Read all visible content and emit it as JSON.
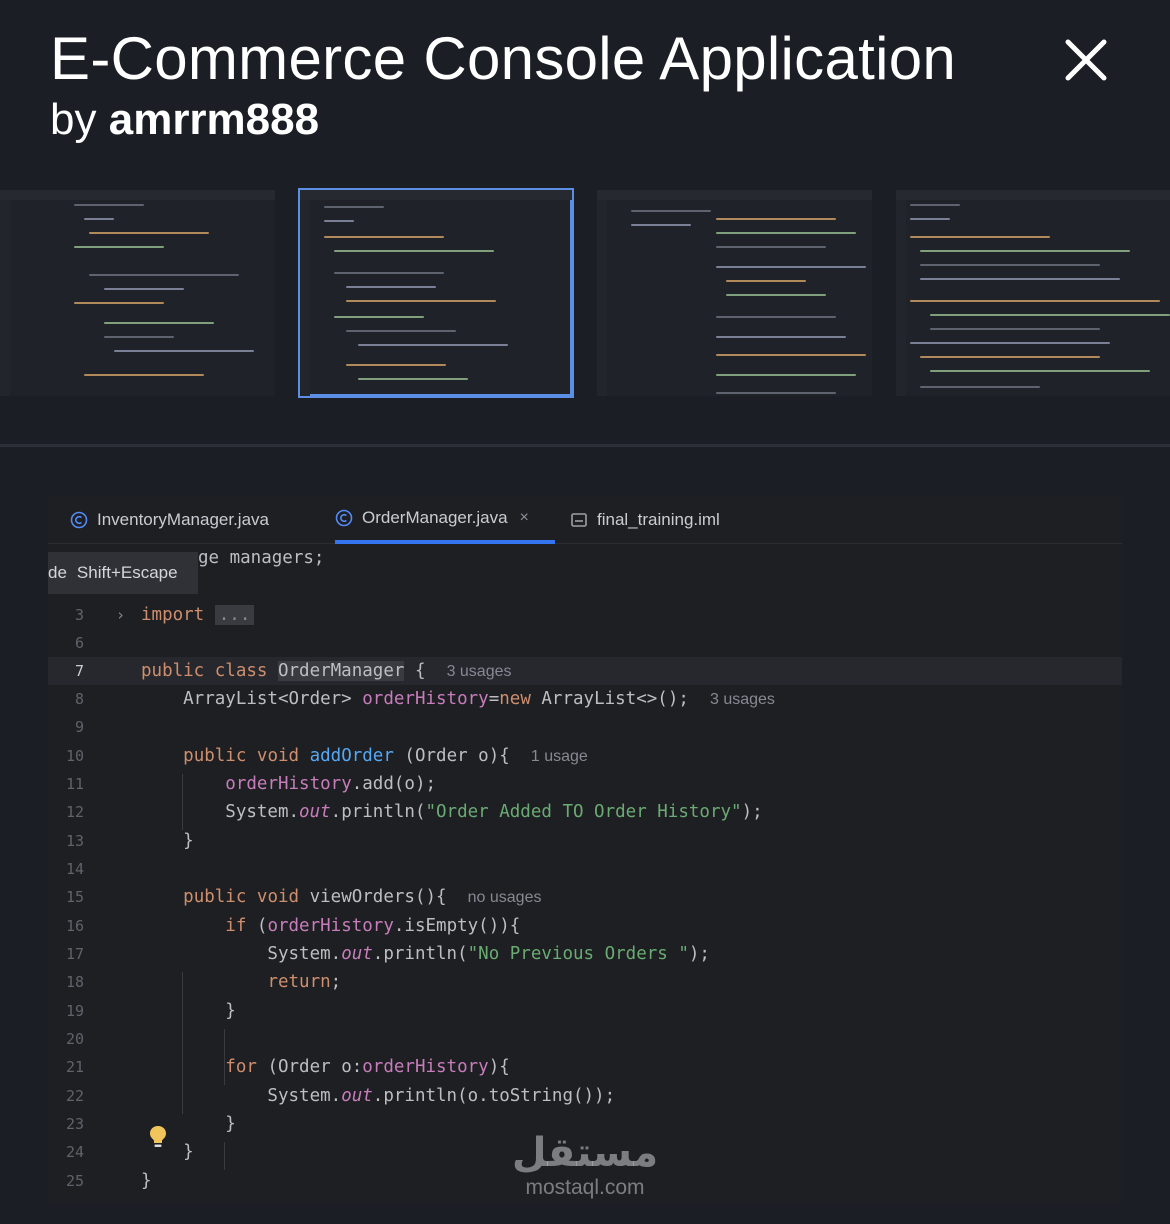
{
  "header": {
    "title": "E-Commerce Console Application",
    "by_prefix": "by",
    "author": "amrrm888",
    "close_icon": "close-icon"
  },
  "thumbnails": {
    "count": 4,
    "selected_index": 1
  },
  "editor": {
    "tabs": [
      {
        "label": "InventoryManager.java",
        "icon": "class-file-icon",
        "active": false
      },
      {
        "label": "OrderManager.java",
        "icon": "class-file-icon",
        "active": true,
        "closable": true
      },
      {
        "label": "final_training.iml",
        "icon": "module-file-icon",
        "active": false
      }
    ],
    "close_tab_glyph": "×",
    "tooltip": {
      "cut_text": "de",
      "shortcut": "Shift+Escape"
    },
    "current_line": "7",
    "lines": [
      {
        "n": "",
        "tokens": [
          {
            "t": "ge managers;"
          }
        ]
      },
      {
        "n": "3",
        "tokens": [
          {
            "t": "import",
            "c": "kw"
          },
          {
            "t": " "
          },
          {
            "t": "...",
            "c": "fold-box"
          }
        ]
      },
      {
        "n": "6",
        "tokens": []
      },
      {
        "n": "7",
        "tokens": [
          {
            "t": "public class ",
            "c": "kw"
          },
          {
            "t": "OrderManager",
            "c": "sel"
          },
          {
            "t": " {  "
          },
          {
            "t": "3 usages",
            "c": "hint"
          }
        ]
      },
      {
        "n": "8",
        "tokens": [
          {
            "t": "    ArrayList<Order> "
          },
          {
            "t": "orderHistory",
            "c": "fld"
          },
          {
            "t": "="
          },
          {
            "t": "new",
            "c": "kw"
          },
          {
            "t": " ArrayList<>();  "
          },
          {
            "t": "3 usages",
            "c": "hint"
          }
        ]
      },
      {
        "n": "9",
        "tokens": []
      },
      {
        "n": "10",
        "tokens": [
          {
            "t": "    "
          },
          {
            "t": "public void ",
            "c": "kw"
          },
          {
            "t": "addOrder",
            "c": "fn"
          },
          {
            "t": " (Order o){  "
          },
          {
            "t": "1 usage",
            "c": "hint"
          }
        ]
      },
      {
        "n": "11",
        "tokens": [
          {
            "t": "        "
          },
          {
            "t": "orderHistory",
            "c": "fld"
          },
          {
            "t": ".add(o);"
          }
        ]
      },
      {
        "n": "12",
        "tokens": [
          {
            "t": "        System."
          },
          {
            "t": "out",
            "c": "it"
          },
          {
            "t": ".println("
          },
          {
            "t": "\"Order Added TO Order History\"",
            "c": "str"
          },
          {
            "t": ");"
          }
        ]
      },
      {
        "n": "13",
        "tokens": [
          {
            "t": "    }"
          }
        ]
      },
      {
        "n": "14",
        "tokens": []
      },
      {
        "n": "15",
        "tokens": [
          {
            "t": "    "
          },
          {
            "t": "public void ",
            "c": "kw"
          },
          {
            "t": "viewOrders(){  "
          },
          {
            "t": "no usages",
            "c": "hint"
          }
        ]
      },
      {
        "n": "16",
        "tokens": [
          {
            "t": "        "
          },
          {
            "t": "if",
            "c": "kw"
          },
          {
            "t": " ("
          },
          {
            "t": "orderHistory",
            "c": "fld"
          },
          {
            "t": ".isEmpty()){"
          }
        ]
      },
      {
        "n": "17",
        "tokens": [
          {
            "t": "            System."
          },
          {
            "t": "out",
            "c": "it"
          },
          {
            "t": ".println("
          },
          {
            "t": "\"No Previous Orders \"",
            "c": "str"
          },
          {
            "t": ");"
          }
        ]
      },
      {
        "n": "18",
        "tokens": [
          {
            "t": "            "
          },
          {
            "t": "return",
            "c": "kw"
          },
          {
            "t": ";"
          }
        ]
      },
      {
        "n": "19",
        "tokens": [
          {
            "t": "        }"
          }
        ]
      },
      {
        "n": "20",
        "tokens": []
      },
      {
        "n": "21",
        "tokens": [
          {
            "t": "        "
          },
          {
            "t": "for",
            "c": "kw"
          },
          {
            "t": " (Order o:"
          },
          {
            "t": "orderHistory",
            "c": "fld"
          },
          {
            "t": "){"
          }
        ]
      },
      {
        "n": "22",
        "tokens": [
          {
            "t": "            System."
          },
          {
            "t": "out",
            "c": "it"
          },
          {
            "t": ".println(o.toString());"
          }
        ]
      },
      {
        "n": "23",
        "tokens": [
          {
            "t": "        }"
          }
        ]
      },
      {
        "n": "24",
        "tokens": [
          {
            "t": "    }"
          }
        ]
      },
      {
        "n": "25",
        "tokens": [
          {
            "t": "}"
          }
        ]
      }
    ]
  },
  "watermark": {
    "arabic": "مستقل",
    "latin": "mostaql.com"
  },
  "colors": {
    "background": "#1b1e25",
    "editor_bg": "#1e1f22",
    "selected_thumb_border": "#5b8fe6",
    "active_tab_underline": "#3574f0",
    "keyword": "#cf8e6d",
    "field": "#c77dbb",
    "method": "#56a8f5",
    "string": "#6aab73"
  }
}
